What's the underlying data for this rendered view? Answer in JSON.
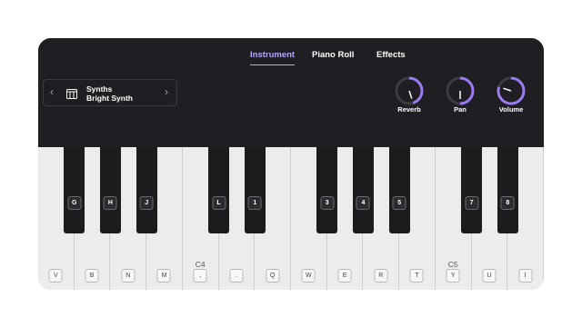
{
  "tabs": [
    {
      "label": "Instrument",
      "active": true
    },
    {
      "label": "Piano Roll",
      "active": false
    },
    {
      "label": "Effects",
      "active": false
    }
  ],
  "preset": {
    "category": "Synths",
    "name": "Bright Synth",
    "prev_icon": "chevron-left-icon",
    "next_icon": "chevron-right-icon",
    "icon": "piano-keys-icon"
  },
  "knobs": [
    {
      "label": "Reverb",
      "value": 0.45
    },
    {
      "label": "Pan",
      "value": 0.5
    },
    {
      "label": "Volume",
      "value": 0.8
    }
  ],
  "keyboard": {
    "white_keys": [
      {
        "key": "V",
        "octave": ""
      },
      {
        "key": "B",
        "octave": ""
      },
      {
        "key": "N",
        "octave": ""
      },
      {
        "key": "M",
        "octave": ""
      },
      {
        "key": ",",
        "octave": "C4"
      },
      {
        "key": ".",
        "octave": ""
      },
      {
        "key": "Q",
        "octave": ""
      },
      {
        "key": "W",
        "octave": ""
      },
      {
        "key": "E",
        "octave": ""
      },
      {
        "key": "R",
        "octave": ""
      },
      {
        "key": "T",
        "octave": ""
      },
      {
        "key": "Y",
        "octave": "C5"
      },
      {
        "key": "U",
        "octave": ""
      },
      {
        "key": "I",
        "octave": ""
      }
    ],
    "black_keys": [
      "G",
      "H",
      "J",
      "L",
      "1",
      "3",
      "4",
      "5",
      "7",
      "8"
    ]
  },
  "colors": {
    "panel_bg": "#1f1e22",
    "accent": "#9b7cf0",
    "white_key": "#ececec",
    "black_key": "#1c1c1f"
  }
}
